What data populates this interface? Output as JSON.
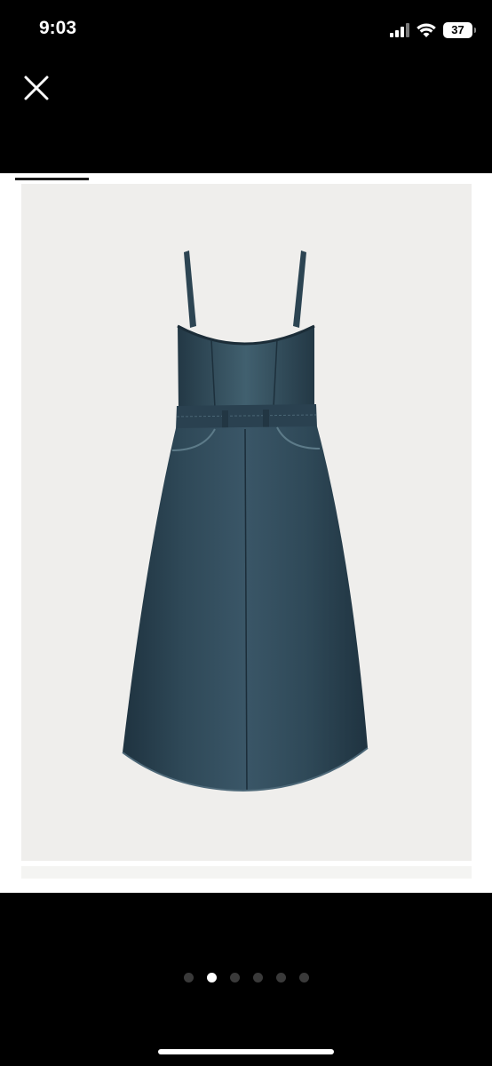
{
  "status_bar": {
    "time": "9:03",
    "battery": "37",
    "icons": [
      "signal-icon",
      "wifi-icon",
      "battery-icon"
    ]
  },
  "toolbar": {
    "close_icon": "close-icon"
  },
  "gallery": {
    "image": "product-photo-denim-dress",
    "progress": 0.15,
    "page_count": 6,
    "current_page": 2
  },
  "colors": {
    "background": "#000000",
    "panel": "#ffffff",
    "photo_background": "#efeeec",
    "denim": "#2d4454",
    "dot_active": "#ffffff",
    "dot_inactive": "#3a3a3a"
  }
}
